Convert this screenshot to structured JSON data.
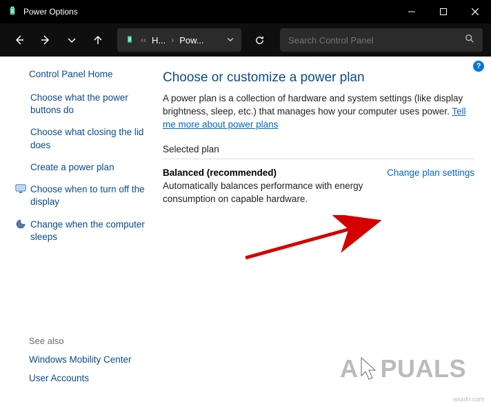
{
  "window": {
    "title": "Power Options"
  },
  "breadcrumb": {
    "item1": "H...",
    "item2": "Pow..."
  },
  "search": {
    "placeholder": "Search Control Panel"
  },
  "sidebar": {
    "home": "Control Panel Home",
    "links": [
      "Choose what the power buttons do",
      "Choose what closing the lid does",
      "Create a power plan",
      "Choose when to turn off the display",
      "Change when the computer sleeps"
    ],
    "see_also_label": "See also",
    "see_also": [
      "Windows Mobility Center",
      "User Accounts"
    ]
  },
  "main": {
    "heading": "Choose or customize a power plan",
    "desc_prefix": "A power plan is a collection of hardware and system settings (like display brightness, sleep, etc.) that manages how your computer uses power. ",
    "desc_link": "Tell me more about power plans",
    "section_label": "Selected plan",
    "plan_name": "Balanced (recommended)",
    "plan_desc": "Automatically balances performance with energy consumption on capable hardware.",
    "change_link": "Change plan settings",
    "help": "?"
  },
  "watermark": {
    "prefix": "A",
    "suffix": "PUALS"
  }
}
